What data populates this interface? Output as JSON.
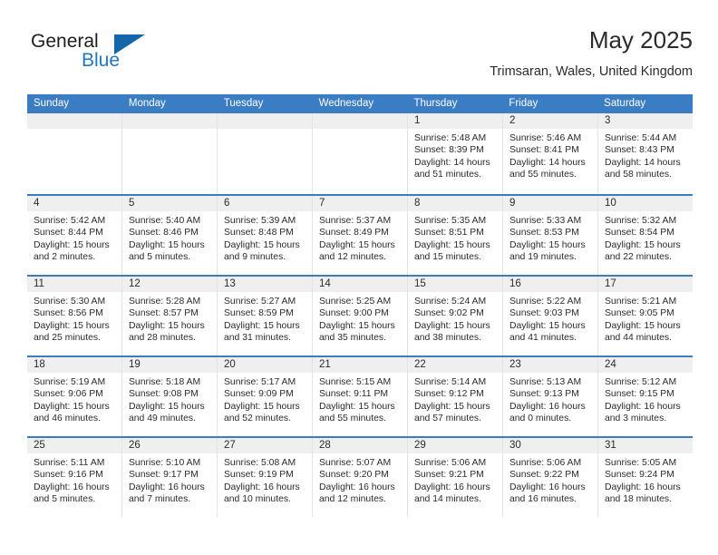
{
  "brand": {
    "name_top": "General",
    "name_bottom": "Blue",
    "accent_color": "#2077c1",
    "triangle_color": "#1466ab"
  },
  "header": {
    "title": "May 2025",
    "subtitle": "Trimsaran, Wales, United Kingdom"
  },
  "theme": {
    "header_row_color": "#3b7dc4",
    "day_strip_color": "#efefef",
    "text_color": "#2b2b2b"
  },
  "weekday_headers": [
    "Sunday",
    "Monday",
    "Tuesday",
    "Wednesday",
    "Thursday",
    "Friday",
    "Saturday"
  ],
  "weeks": [
    [
      {
        "day": "",
        "lines": []
      },
      {
        "day": "",
        "lines": []
      },
      {
        "day": "",
        "lines": []
      },
      {
        "day": "",
        "lines": []
      },
      {
        "day": "1",
        "lines": [
          "Sunrise: 5:48 AM",
          "Sunset: 8:39 PM",
          "Daylight: 14 hours",
          "and 51 minutes."
        ]
      },
      {
        "day": "2",
        "lines": [
          "Sunrise: 5:46 AM",
          "Sunset: 8:41 PM",
          "Daylight: 14 hours",
          "and 55 minutes."
        ]
      },
      {
        "day": "3",
        "lines": [
          "Sunrise: 5:44 AM",
          "Sunset: 8:43 PM",
          "Daylight: 14 hours",
          "and 58 minutes."
        ]
      }
    ],
    [
      {
        "day": "4",
        "lines": [
          "Sunrise: 5:42 AM",
          "Sunset: 8:44 PM",
          "Daylight: 15 hours",
          "and 2 minutes."
        ]
      },
      {
        "day": "5",
        "lines": [
          "Sunrise: 5:40 AM",
          "Sunset: 8:46 PM",
          "Daylight: 15 hours",
          "and 5 minutes."
        ]
      },
      {
        "day": "6",
        "lines": [
          "Sunrise: 5:39 AM",
          "Sunset: 8:48 PM",
          "Daylight: 15 hours",
          "and 9 minutes."
        ]
      },
      {
        "day": "7",
        "lines": [
          "Sunrise: 5:37 AM",
          "Sunset: 8:49 PM",
          "Daylight: 15 hours",
          "and 12 minutes."
        ]
      },
      {
        "day": "8",
        "lines": [
          "Sunrise: 5:35 AM",
          "Sunset: 8:51 PM",
          "Daylight: 15 hours",
          "and 15 minutes."
        ]
      },
      {
        "day": "9",
        "lines": [
          "Sunrise: 5:33 AM",
          "Sunset: 8:53 PM",
          "Daylight: 15 hours",
          "and 19 minutes."
        ]
      },
      {
        "day": "10",
        "lines": [
          "Sunrise: 5:32 AM",
          "Sunset: 8:54 PM",
          "Daylight: 15 hours",
          "and 22 minutes."
        ]
      }
    ],
    [
      {
        "day": "11",
        "lines": [
          "Sunrise: 5:30 AM",
          "Sunset: 8:56 PM",
          "Daylight: 15 hours",
          "and 25 minutes."
        ]
      },
      {
        "day": "12",
        "lines": [
          "Sunrise: 5:28 AM",
          "Sunset: 8:57 PM",
          "Daylight: 15 hours",
          "and 28 minutes."
        ]
      },
      {
        "day": "13",
        "lines": [
          "Sunrise: 5:27 AM",
          "Sunset: 8:59 PM",
          "Daylight: 15 hours",
          "and 31 minutes."
        ]
      },
      {
        "day": "14",
        "lines": [
          "Sunrise: 5:25 AM",
          "Sunset: 9:00 PM",
          "Daylight: 15 hours",
          "and 35 minutes."
        ]
      },
      {
        "day": "15",
        "lines": [
          "Sunrise: 5:24 AM",
          "Sunset: 9:02 PM",
          "Daylight: 15 hours",
          "and 38 minutes."
        ]
      },
      {
        "day": "16",
        "lines": [
          "Sunrise: 5:22 AM",
          "Sunset: 9:03 PM",
          "Daylight: 15 hours",
          "and 41 minutes."
        ]
      },
      {
        "day": "17",
        "lines": [
          "Sunrise: 5:21 AM",
          "Sunset: 9:05 PM",
          "Daylight: 15 hours",
          "and 44 minutes."
        ]
      }
    ],
    [
      {
        "day": "18",
        "lines": [
          "Sunrise: 5:19 AM",
          "Sunset: 9:06 PM",
          "Daylight: 15 hours",
          "and 46 minutes."
        ]
      },
      {
        "day": "19",
        "lines": [
          "Sunrise: 5:18 AM",
          "Sunset: 9:08 PM",
          "Daylight: 15 hours",
          "and 49 minutes."
        ]
      },
      {
        "day": "20",
        "lines": [
          "Sunrise: 5:17 AM",
          "Sunset: 9:09 PM",
          "Daylight: 15 hours",
          "and 52 minutes."
        ]
      },
      {
        "day": "21",
        "lines": [
          "Sunrise: 5:15 AM",
          "Sunset: 9:11 PM",
          "Daylight: 15 hours",
          "and 55 minutes."
        ]
      },
      {
        "day": "22",
        "lines": [
          "Sunrise: 5:14 AM",
          "Sunset: 9:12 PM",
          "Daylight: 15 hours",
          "and 57 minutes."
        ]
      },
      {
        "day": "23",
        "lines": [
          "Sunrise: 5:13 AM",
          "Sunset: 9:13 PM",
          "Daylight: 16 hours",
          "and 0 minutes."
        ]
      },
      {
        "day": "24",
        "lines": [
          "Sunrise: 5:12 AM",
          "Sunset: 9:15 PM",
          "Daylight: 16 hours",
          "and 3 minutes."
        ]
      }
    ],
    [
      {
        "day": "25",
        "lines": [
          "Sunrise: 5:11 AM",
          "Sunset: 9:16 PM",
          "Daylight: 16 hours",
          "and 5 minutes."
        ]
      },
      {
        "day": "26",
        "lines": [
          "Sunrise: 5:10 AM",
          "Sunset: 9:17 PM",
          "Daylight: 16 hours",
          "and 7 minutes."
        ]
      },
      {
        "day": "27",
        "lines": [
          "Sunrise: 5:08 AM",
          "Sunset: 9:19 PM",
          "Daylight: 16 hours",
          "and 10 minutes."
        ]
      },
      {
        "day": "28",
        "lines": [
          "Sunrise: 5:07 AM",
          "Sunset: 9:20 PM",
          "Daylight: 16 hours",
          "and 12 minutes."
        ]
      },
      {
        "day": "29",
        "lines": [
          "Sunrise: 5:06 AM",
          "Sunset: 9:21 PM",
          "Daylight: 16 hours",
          "and 14 minutes."
        ]
      },
      {
        "day": "30",
        "lines": [
          "Sunrise: 5:06 AM",
          "Sunset: 9:22 PM",
          "Daylight: 16 hours",
          "and 16 minutes."
        ]
      },
      {
        "day": "31",
        "lines": [
          "Sunrise: 5:05 AM",
          "Sunset: 9:24 PM",
          "Daylight: 16 hours",
          "and 18 minutes."
        ]
      }
    ]
  ]
}
